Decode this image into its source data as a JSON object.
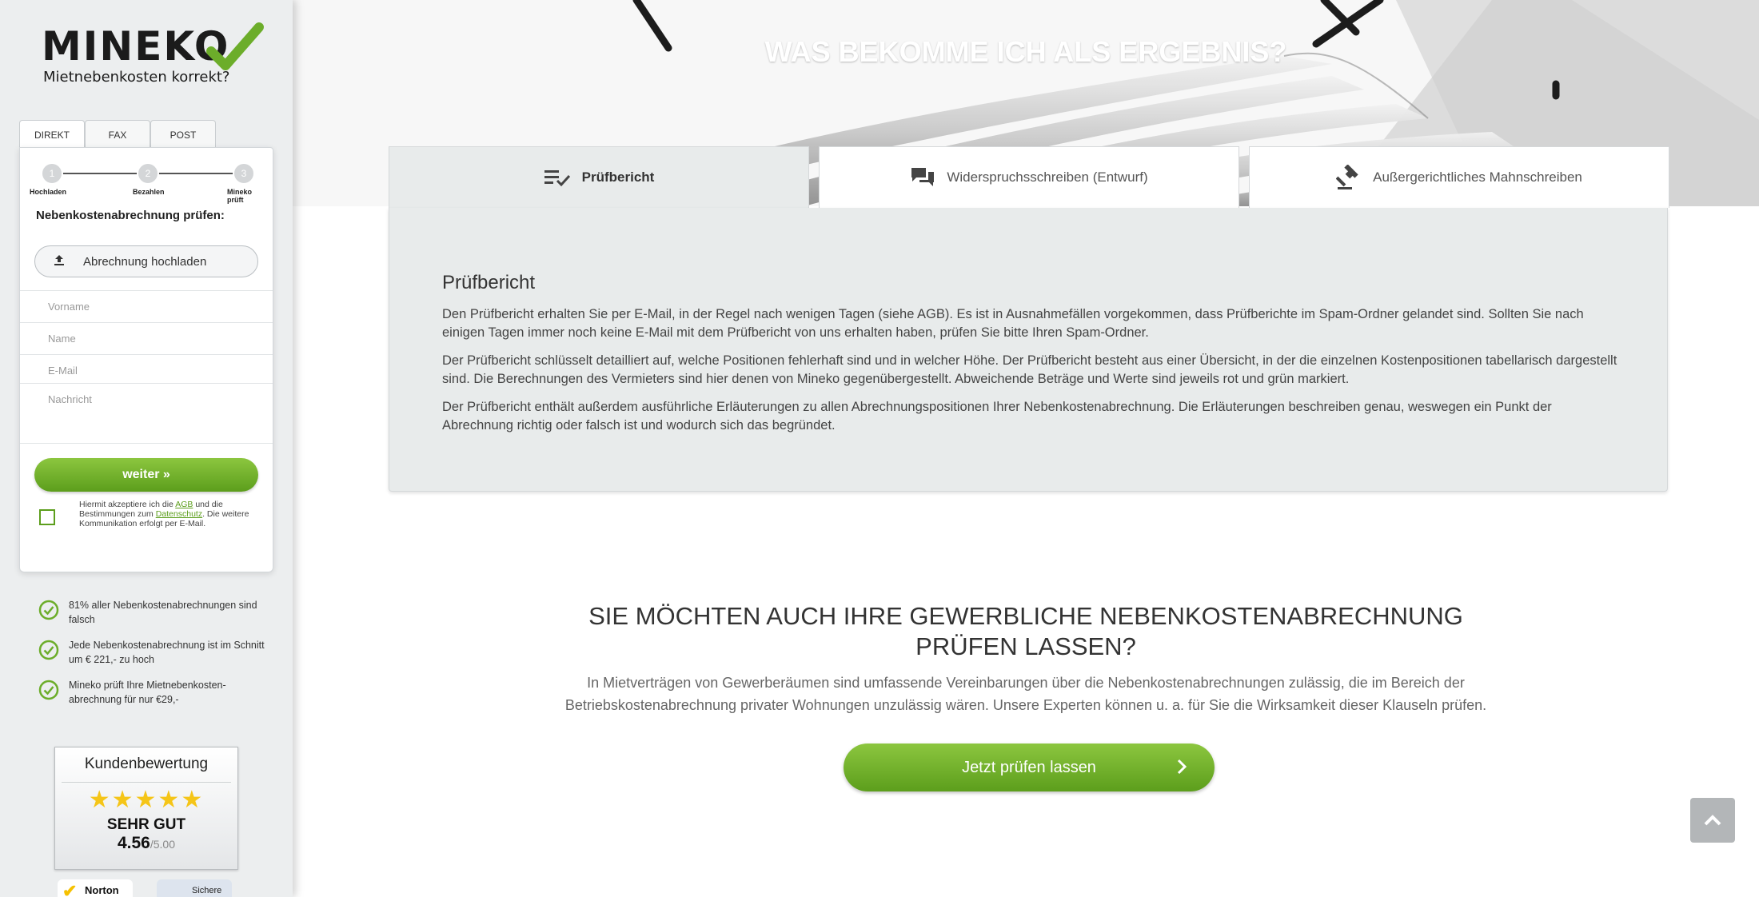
{
  "brand": {
    "name": "MINEKO",
    "tagline": "Mietnebenkosten korrekt?",
    "accent": "#6cad2a"
  },
  "form": {
    "tabs": [
      {
        "label": "DIREKT",
        "active": true
      },
      {
        "label": "FAX",
        "active": false
      },
      {
        "label": "POST",
        "active": false
      }
    ],
    "steps": [
      {
        "number": "1",
        "label": "Hochladen"
      },
      {
        "number": "2",
        "label": "Bezahlen"
      },
      {
        "number": "3",
        "label": "Mineko prüft"
      }
    ],
    "heading": "Nebenkostenabrechnung prüfen:",
    "upload_label": "Abrechnung hochladen",
    "fields": {
      "firstname_placeholder": "Vorname",
      "name_placeholder": "Name",
      "email_placeholder": "E-Mail",
      "message_placeholder": "Nachricht"
    },
    "submit_label": "weiter »",
    "terms": {
      "prefix": "Hiermit akzeptiere ich die",
      "agb_link": "AGB",
      "middle": "und die Bestimmungen zum",
      "privacy_link": "Datenschutz",
      "suffix": ". Die weitere Kommunikation erfolgt per E-Mail."
    }
  },
  "benefits": [
    "81% aller Nebenkostenabrechnungen sind falsch",
    "Jede Nebenkostenabrechnung ist im Schnitt um € 221,- zu hoch",
    "Mineko prüft Ihre Mietnebenkosten-abrechnung für nur €29,-"
  ],
  "rating": {
    "title": "Kundenbewertung",
    "stars": 5,
    "label": "SEHR GUT",
    "score": "4.56",
    "max": "/5.00"
  },
  "badges": {
    "norton": "Norton",
    "secure": "Sichere"
  },
  "hero": {
    "title": "WAS BEKOMME ICH ALS ERGEBNIS?"
  },
  "result_tabs": [
    {
      "label": "Prüfbericht",
      "icon": "checklist-icon",
      "active": true
    },
    {
      "label": "Widerspruchsschreiben (Entwurf)",
      "icon": "chat-icon",
      "active": false
    },
    {
      "label": "Außergerichtliches Mahnschreiben",
      "icon": "gavel-icon",
      "active": false
    }
  ],
  "panel": {
    "title": "Prüfbericht",
    "paragraphs": [
      "Den Prüfbericht erhalten Sie per E-Mail, in der Regel nach wenigen Tagen (siehe AGB). Es ist in Ausnahmefällen vorgekommen, dass Prüfberichte im Spam-Ordner gelandet sind. Sollten Sie nach einigen Tagen immer noch keine E-Mail mit dem Prüfbericht von uns erhalten haben, prüfen Sie bitte Ihren Spam-Ordner.",
      "Der Prüfbericht schlüsselt detailliert auf, welche Positionen fehlerhaft sind und in welcher Höhe. Der Prüfbericht besteht aus einer Übersicht, in der die einzelnen Kostenpositionen tabellarisch dargestellt sind. Die Berechnungen des Vermieters sind hier denen von Mineko gegenübergestellt. Abweichende Beträge und Werte sind jeweils rot und grün markiert.",
      "Der Prüfbericht enthält außerdem ausführliche Erläuterungen zu allen Abrechnungspositionen Ihrer Nebenkostenabrechnung. Die Erläuterungen beschreiben genau, weswegen ein Punkt der Abrechnung richtig oder falsch ist und wodurch sich das begründet."
    ]
  },
  "cta": {
    "title_line1": "SIE MÖCHTEN AUCH IHRE GEWERBLICHE NEBENKOSTENABRECHNUNG",
    "title_line2": "PRÜFEN LASSEN?",
    "text_line1": "In Mietverträgen von Gewerberäumen sind umfassende Vereinbarungen über die Nebenkostenabrechnungen zulässig, die im Bereich der",
    "text_line2": "Betriebskostenabrechnung privater Wohnungen unzulässig wären. Unsere Experten können u. a. für Sie die Wirksamkeit dieser Klauseln prüfen.",
    "button_label": "Jetzt prüfen lassen"
  }
}
